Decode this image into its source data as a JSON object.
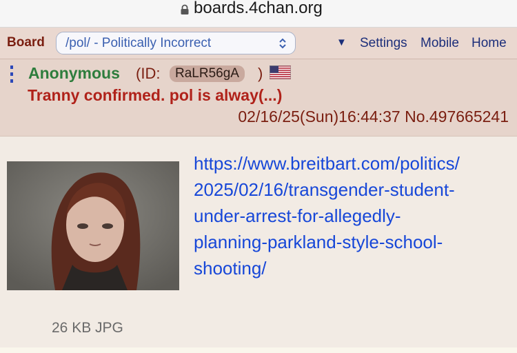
{
  "browser": {
    "url": "boards.4chan.org"
  },
  "nav": {
    "board_label": "Board",
    "board_selected": "/pol/ - Politically Incorrect",
    "menu_arrow": "▼",
    "links": [
      "Settings",
      "Mobile",
      "Home"
    ]
  },
  "post": {
    "name": "Anonymous",
    "id_prefix": "(ID:",
    "id_value": "RaLR56gA",
    "id_suffix": ")",
    "flag_icon": "us-flag-icon",
    "subject": "Tranny confirmed. pol is alway(...)",
    "meta": "02/16/25(Sun)16:44:37 No.497665241",
    "comment_lines": [
      "https://www.breitbart.com/politics/",
      "2025/02/16/transgender-student-",
      "under-arrest-for-allegedly-",
      "planning-parkland-style-school-",
      "shooting/"
    ],
    "file_info": "26 KB JPG"
  },
  "colors": {
    "name_green": "#2e7d3d",
    "subject_red": "#b0221a",
    "link_blue": "#1747d8",
    "header_bg": "#e6d4cb",
    "body_bg": "#f2ebe4"
  }
}
